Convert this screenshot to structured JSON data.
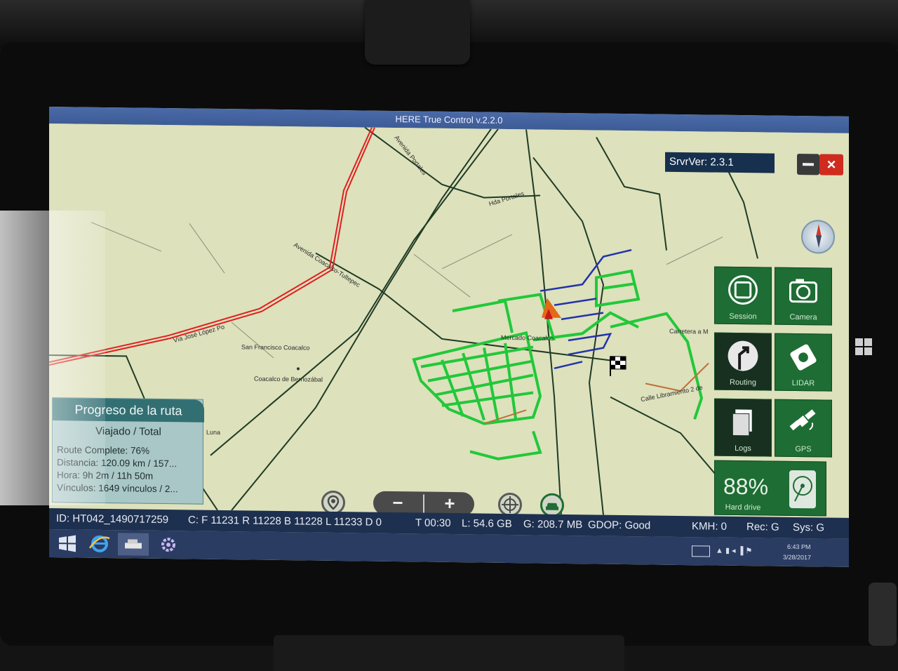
{
  "window": {
    "title": "HERE True Control v.2.2.0",
    "server_version": "SrvrVer: 2.3.1"
  },
  "map": {
    "labels": [
      "Avenida Portales",
      "Hda Portales",
      "Avenida Coacalco-Tultepec",
      "Vía José López Po",
      "San Francisco Coacalco",
      "Coacalco de Berriozábal",
      "Carretera a M",
      "Calle Libramiento 2 de",
      "Mercado Coacalco",
      "Luna"
    ],
    "colors": {
      "background": "#dde1bc",
      "driven_roads": "#22c83a",
      "planned_roads": "#2233aa",
      "main_road": "#e02020",
      "local_roads": "#1f3b24"
    }
  },
  "tiles": {
    "session": {
      "label": "Session",
      "icon": "stop-square-icon"
    },
    "camera": {
      "label": "Camera",
      "icon": "camera-icon"
    },
    "routing": {
      "label": "Routing",
      "icon": "turn-right-arrow-icon"
    },
    "lidar": {
      "label": "LIDAR",
      "icon": "lidar-icon"
    },
    "logs": {
      "label": "Logs",
      "icon": "documents-icon"
    },
    "gps": {
      "label": "GPS",
      "icon": "satellite-icon"
    },
    "hard_drive": {
      "label": "Hard drive",
      "value": "88%",
      "icon": "hard-disk-icon"
    }
  },
  "progress": {
    "title": "Progreso de la ruta",
    "subtitle": "Viajado / Total",
    "route_complete": "Route Complete: 76%",
    "distance": "Distancia: 120.09 km / 157...",
    "time": "Hora: 9h 2m / 11h 50m",
    "links": "Vínculos: 1649 vínculos / 2..."
  },
  "controls": {
    "zoom_out": "−",
    "zoom_in": "+",
    "icons": [
      "location-pin-icon",
      "crosshair-icon",
      "car-icon"
    ]
  },
  "status": {
    "id": "ID: HT042_1490717259",
    "counters": "C: F 11231 R 11228 B 11228 L 11233 D 0",
    "time": "T 00:30",
    "disk": "L:  54.6 GB",
    "gps": "G: 208.7 MB",
    "gdop": "GDOP: Good",
    "speed": "KMH: 0",
    "rec": "Rec: G",
    "sys": "Sys: G"
  },
  "taskbar": {
    "icons": [
      "windows-start-icon",
      "internet-explorer-icon",
      "vehicle-app-icon",
      "settings-gear-icon"
    ],
    "clock_time": "6:43 PM",
    "clock_date": "3/28/2017"
  }
}
